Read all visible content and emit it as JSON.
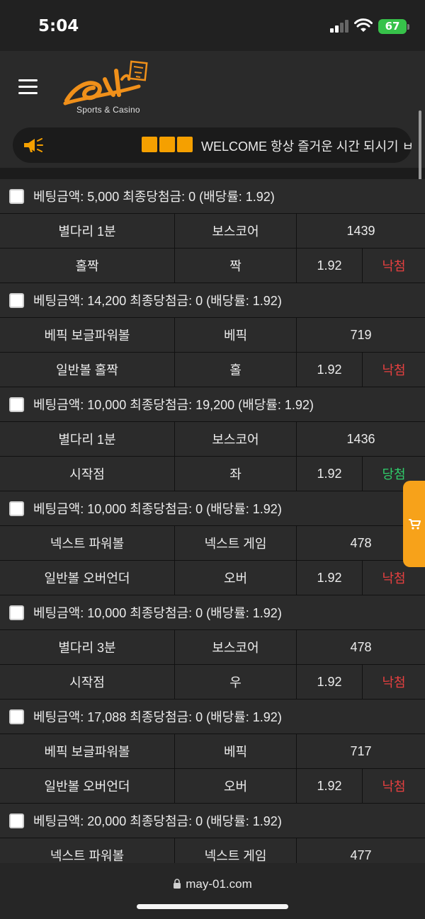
{
  "status_bar": {
    "time": "5:04",
    "battery": "67"
  },
  "header": {
    "logo_text": "Sports & Casino",
    "marquee_text": "WELCOME 항상 즐거운 시간 되시기 ㅂ"
  },
  "bets": [
    {
      "header": "베팅금액: 5,000 최종당첨금: 0 (배당률: 1.92)",
      "game": "별다리 1분",
      "market": "보스코어",
      "round": "1439",
      "pick": "홀짝",
      "choice": "짝",
      "odds": "1.92",
      "result": "낙첨",
      "win": false
    },
    {
      "header": "베팅금액: 14,200 최종당첨금: 0 (배당률: 1.92)",
      "game": "베픽 보글파워볼",
      "market": "베픽",
      "round": "719",
      "pick": "일반볼 홀짝",
      "choice": "홀",
      "odds": "1.92",
      "result": "낙첨",
      "win": false
    },
    {
      "header": "베팅금액: 10,000 최종당첨금: 19,200 (배당률: 1.92)",
      "game": "별다리 1분",
      "market": "보스코어",
      "round": "1436",
      "pick": "시작점",
      "choice": "좌",
      "odds": "1.92",
      "result": "당첨",
      "win": true
    },
    {
      "header": "베팅금액: 10,000 최종당첨금: 0 (배당률: 1.92)",
      "game": "넥스트 파워볼",
      "market": "넥스트 게임",
      "round": "478",
      "pick": "일반볼 오버언더",
      "choice": "오버",
      "odds": "1.92",
      "result": "낙첨",
      "win": false
    },
    {
      "header": "베팅금액: 10,000 최종당첨금: 0 (배당률: 1.92)",
      "game": "별다리 3분",
      "market": "보스코어",
      "round": "478",
      "pick": "시작점",
      "choice": "우",
      "odds": "1.92",
      "result": "낙첨",
      "win": false
    },
    {
      "header": "베팅금액: 17,088 최종당첨금: 0 (배당률: 1.92)",
      "game": "베픽 보글파워볼",
      "market": "베픽",
      "round": "717",
      "pick": "일반볼 오버언더",
      "choice": "오버",
      "odds": "1.92",
      "result": "낙첨",
      "win": false
    },
    {
      "header": "베팅금액: 20,000 최종당첨금: 0 (배당률: 1.92)",
      "game": "넥스트 파워볼",
      "market": "넥스트 게임",
      "round": "477",
      "pick": "",
      "choice": "",
      "odds": "",
      "result": "",
      "win": false
    }
  ],
  "colors": {
    "lose": "#e64040",
    "win": "#2fcc6a",
    "accent": "#f5a000"
  },
  "icons": [
    "hamburger-icon",
    "megaphone-icon",
    "cart-icon",
    "lock-icon"
  ],
  "browser": {
    "url": "may-01.com"
  }
}
